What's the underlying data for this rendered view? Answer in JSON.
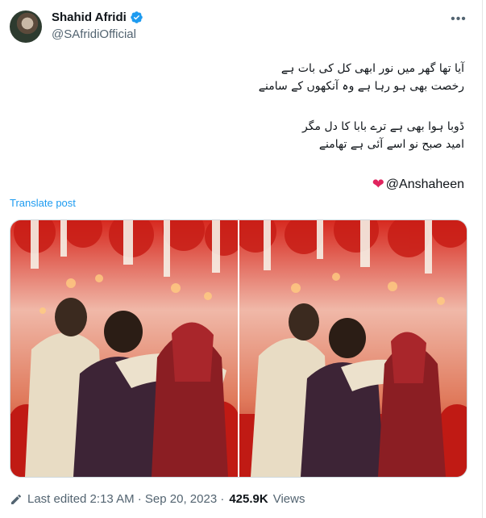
{
  "author": {
    "name": "Shahid Afridi",
    "handle": "@SAfridiOfficial",
    "verified_color": "#1d9bf0"
  },
  "post": {
    "lines": [
      "آیا تھا گھر میں نور ابھی کل کی بات ہے",
      "رخصت بھی ہو رہا ہے وہ آنکھوں کے سامنے",
      "ڈوبا ہوا بھی ہے ترے بابا کا دل مگر",
      "امید صبح نو اسے آئی ہے تھامنے"
    ],
    "mention": "@Anshaheen",
    "translate_label": "Translate post"
  },
  "footer": {
    "edited_label": "Last edited 2:13 AM · Sep 20, 2023 ·",
    "views_count": "425.9K",
    "views_label": "Views"
  },
  "colors": {
    "accent": "#1d9bf0",
    "heart": "#e0245e",
    "secondary_text": "#536471"
  }
}
